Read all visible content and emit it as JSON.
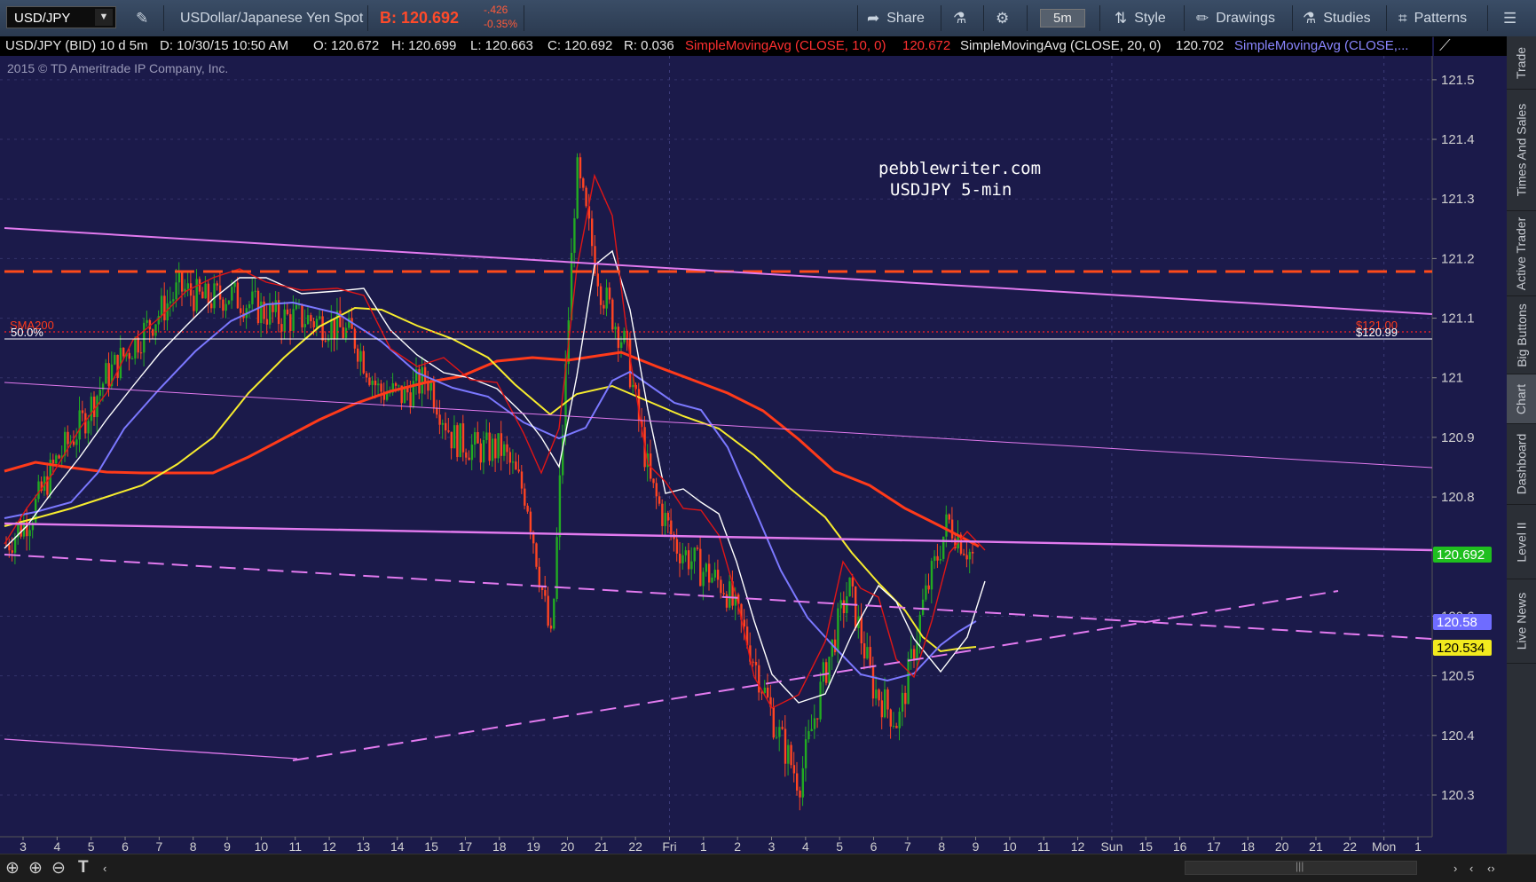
{
  "toolbar": {
    "symbol": "USD/JPY",
    "description": "USDollar/Japanese Yen Spot",
    "bid": "B: 120.692",
    "change": "-.426",
    "change_pct": "-0.35%",
    "share": "Share",
    "timeframe": "5m",
    "style": "Style",
    "drawings": "Drawings",
    "studies": "Studies",
    "patterns": "Patterns"
  },
  "infobar": {
    "symbol": "USD/JPY (BID) 10 d 5m",
    "date": "D: 10/30/15 10:50 AM",
    "open": "O: 120.672",
    "high": "H: 120.699",
    "low": "L: 120.663",
    "close": "C: 120.692",
    "range": "R: 0.036",
    "sma10_label": "SimpleMovingAvg (CLOSE, 10, 0)",
    "sma10_value": "120.672",
    "sma20_label": "SimpleMovingAvg (CLOSE, 20, 0)",
    "sma20_value": "120.702",
    "sma50_label": "SimpleMovingAvg (CLOSE,..."
  },
  "copyright": "2015 © TD Ameritrade IP Company, Inc.",
  "annotations": {
    "site": "pebblewriter.com",
    "subtitle": "USDJPY 5-min",
    "sma200_label": "SMA200",
    "fib_label": "50.0%",
    "fib_value": "$120.99",
    "target_value": "$121.00"
  },
  "price_tags": {
    "last": "120.692",
    "blue": "120.58",
    "yellow": "120.534"
  },
  "right_tabs": [
    "Trade",
    "Times And Sales",
    "Active Trader",
    "Big Buttons",
    "Chart",
    "Dashboard",
    "Level II",
    "Live News"
  ],
  "chart_data": {
    "type": "candlestick",
    "y_ticks": [
      "121.5",
      "121.4",
      "121.3",
      "121.2",
      "121.1",
      "121",
      "120.9",
      "120.8",
      "120.6",
      "120.5",
      "120.4",
      "120.3"
    ],
    "ylim": [
      120.23,
      121.54
    ],
    "x_ticks": [
      "3",
      "4",
      "5",
      "6",
      "7",
      "8",
      "9",
      "10",
      "11",
      "12",
      "13",
      "14",
      "15",
      "17",
      "18",
      "19",
      "20",
      "21",
      "22",
      "Fri",
      "1",
      "2",
      "3",
      "4",
      "5",
      "6",
      "7",
      "8",
      "9",
      "10",
      "11",
      "12",
      "Sun",
      "15",
      "16",
      "17",
      "18",
      "20",
      "21",
      "22",
      "Mon",
      "1"
    ],
    "price_path": [
      120.72,
      120.77,
      120.86,
      120.92,
      121.0,
      121.05,
      121.1,
      121.15,
      121.13,
      121.14,
      121.12,
      121.1,
      121.1,
      121.09,
      121.07,
      120.98,
      120.97,
      121.0,
      120.9,
      120.88,
      120.88,
      120.8,
      120.55,
      121.35,
      121.15,
      121.05,
      120.82,
      120.72,
      120.68,
      120.65,
      120.55,
      120.42,
      120.32,
      120.5,
      120.65,
      120.48,
      120.42,
      120.62,
      120.76,
      120.7
    ],
    "series": [
      {
        "name": "SimpleMovingAvg (CLOSE, 10, 0)",
        "color": "#ff2a2a"
      },
      {
        "name": "SimpleMovingAvg (CLOSE, 20, 0)",
        "color": "#ffffff"
      },
      {
        "name": "SimpleMovingAvg (CLOSE,...",
        "color": "#7b78ff"
      }
    ]
  },
  "colors": {
    "background": "#1b1a4a",
    "up": "#22aa22",
    "down": "#ff4422",
    "trendline": "#e27aef"
  }
}
